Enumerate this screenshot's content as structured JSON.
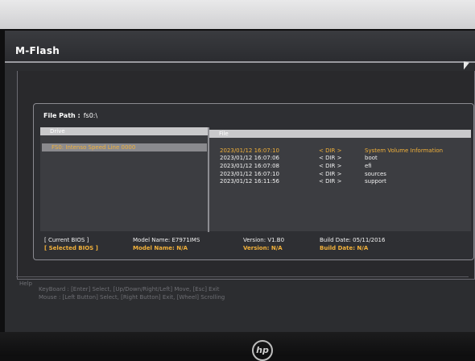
{
  "window": {
    "title": "M-Flash"
  },
  "file_path": {
    "label": "File Path :",
    "value": "fs0:\\"
  },
  "drive_panel": {
    "header": "Drive",
    "items": [
      {
        "label": "FS0: Intenso Speed Line 0000",
        "selected": true
      }
    ]
  },
  "file_panel": {
    "header": "File",
    "rows": [
      {
        "datetime": "2023/01/12 16:07:10",
        "type": "< DIR >",
        "name": "System Volume Information",
        "selected": true
      },
      {
        "datetime": "2023/01/12 16:07:06",
        "type": "< DIR >",
        "name": "boot",
        "selected": false
      },
      {
        "datetime": "2023/01/12 16:07:08",
        "type": "< DIR >",
        "name": "efi",
        "selected": false
      },
      {
        "datetime": "2023/01/12 16:07:10",
        "type": "< DIR >",
        "name": "sources",
        "selected": false
      },
      {
        "datetime": "2023/01/12 16:11:56",
        "type": "< DIR >",
        "name": "support",
        "selected": false
      }
    ]
  },
  "bios_info": {
    "current": {
      "label": "[ Current BIOS  ]",
      "model": "Model Name: E7971IMS",
      "version": "Version: V1.B0",
      "build": "Build Date: 05/11/2016"
    },
    "selected": {
      "label": "[ Selected BIOS ]",
      "model": "Model Name: N/A",
      "version": "Version: N/A",
      "build": "Build Date: N/A"
    }
  },
  "help": {
    "title": "Help",
    "keyboard": "KeyBoard :  [Enter] Select,  [Up/Down/Right/Left] Move,  [Esc] Exit",
    "mouse": "Mouse     :  [Left Button] Select,  [Right Button] Exit,  [Wheel] Scrolling"
  },
  "monitor": {
    "brand_logo": "hp"
  },
  "colors": {
    "selected_text": "#f2b13a",
    "text": "#f2f2f2",
    "background": "#2c2d30",
    "help_text": "#6e6f74"
  }
}
